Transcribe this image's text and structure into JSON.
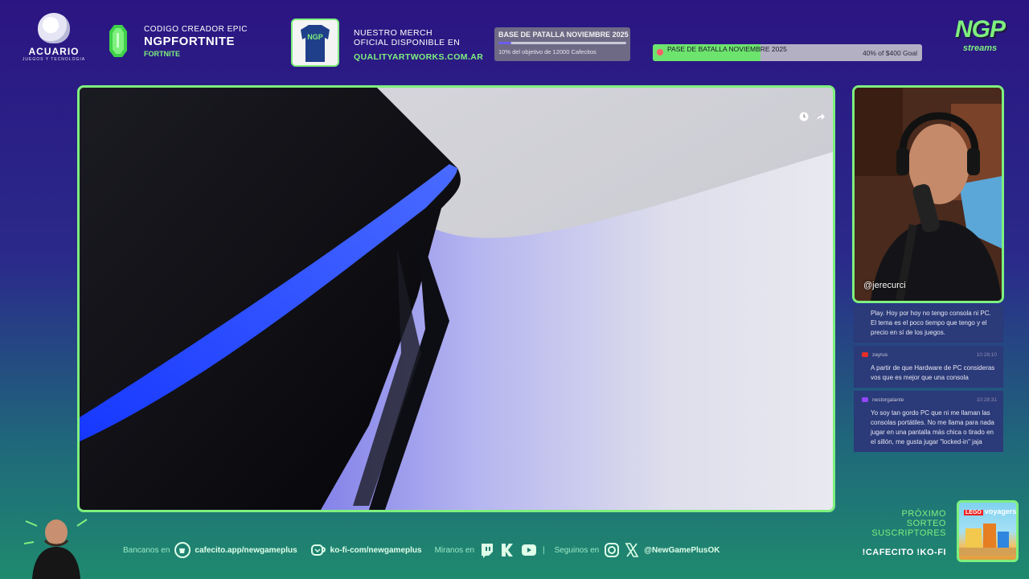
{
  "header": {
    "acuario": {
      "name": "ACUARIO",
      "tagline": "JUEGOS Y TECNOLOGIA"
    },
    "creator_code": {
      "line1": "CODIGO CREADOR EPIC",
      "code": "NGPFORTNITE",
      "game": "FORTNITE"
    },
    "merch": {
      "line1": "NUESTRO MERCH",
      "line2": "OFICIAL DISPONIBLE EN",
      "url": "QUALITYARTWORKS.COM.AR"
    },
    "goal_box": {
      "title": "BASE DE PATALLA NOVIEMBRE 2025",
      "subtitle": "10% del objetivo de 12000 Cafecitos",
      "progress_pct": 10
    },
    "goal_bar": {
      "title": "PASE DE BATALLA NOVIEMBRE 2025",
      "label": "40% of $400 Goal",
      "progress_pct": 40
    },
    "brand": {
      "big": "NGP",
      "small": "streams"
    }
  },
  "camera": {
    "handle": "@jerecurci"
  },
  "chat": {
    "messages": [
      {
        "user": "",
        "time": "",
        "platform": "",
        "text": "Play. Hoy por hoy no tengo consola ni PC. El tema es el poco tiempo que tengo y el precio en sí de los juegos."
      },
      {
        "user": "zayrus",
        "time": "10:28:10",
        "platform": "youtube",
        "text": "A partir de que Hardware de PC consideras vos que es mejor que una consola"
      },
      {
        "user": "nestorgalante",
        "time": "10:28:31",
        "platform": "twitch",
        "text": "Yo soy tan gordo PC que ni me llaman las consolas portátiles. No me llama para nada jugar en una pantalla más chica o tirado en el sillón, me gusta jugar \"locked-in\" jaja"
      }
    ]
  },
  "footer": {
    "bancanos_label": "Bancanos en",
    "cafecito": "cafecito.app/newgameplus",
    "kofi": "ko-fi-com/newgameplus",
    "miranos_label": "Miranos en",
    "seguinos_label": "Seguinos en",
    "social_handle": "@NewGamePlusOK",
    "separator": "|"
  },
  "sorteo": {
    "line1": "PRÓXIMO",
    "line2": "SORTEO",
    "line3": "SUSCRIPTORES",
    "commands": "!CAFECITO !KO-FI",
    "prize_title": "voyagers",
    "prize_brand": "LEGO"
  },
  "colors": {
    "accent": "#7ef07e",
    "bg_top": "#2b1582",
    "bg_bottom": "#1f8a6e",
    "chat_bg": "#2b3a78"
  }
}
